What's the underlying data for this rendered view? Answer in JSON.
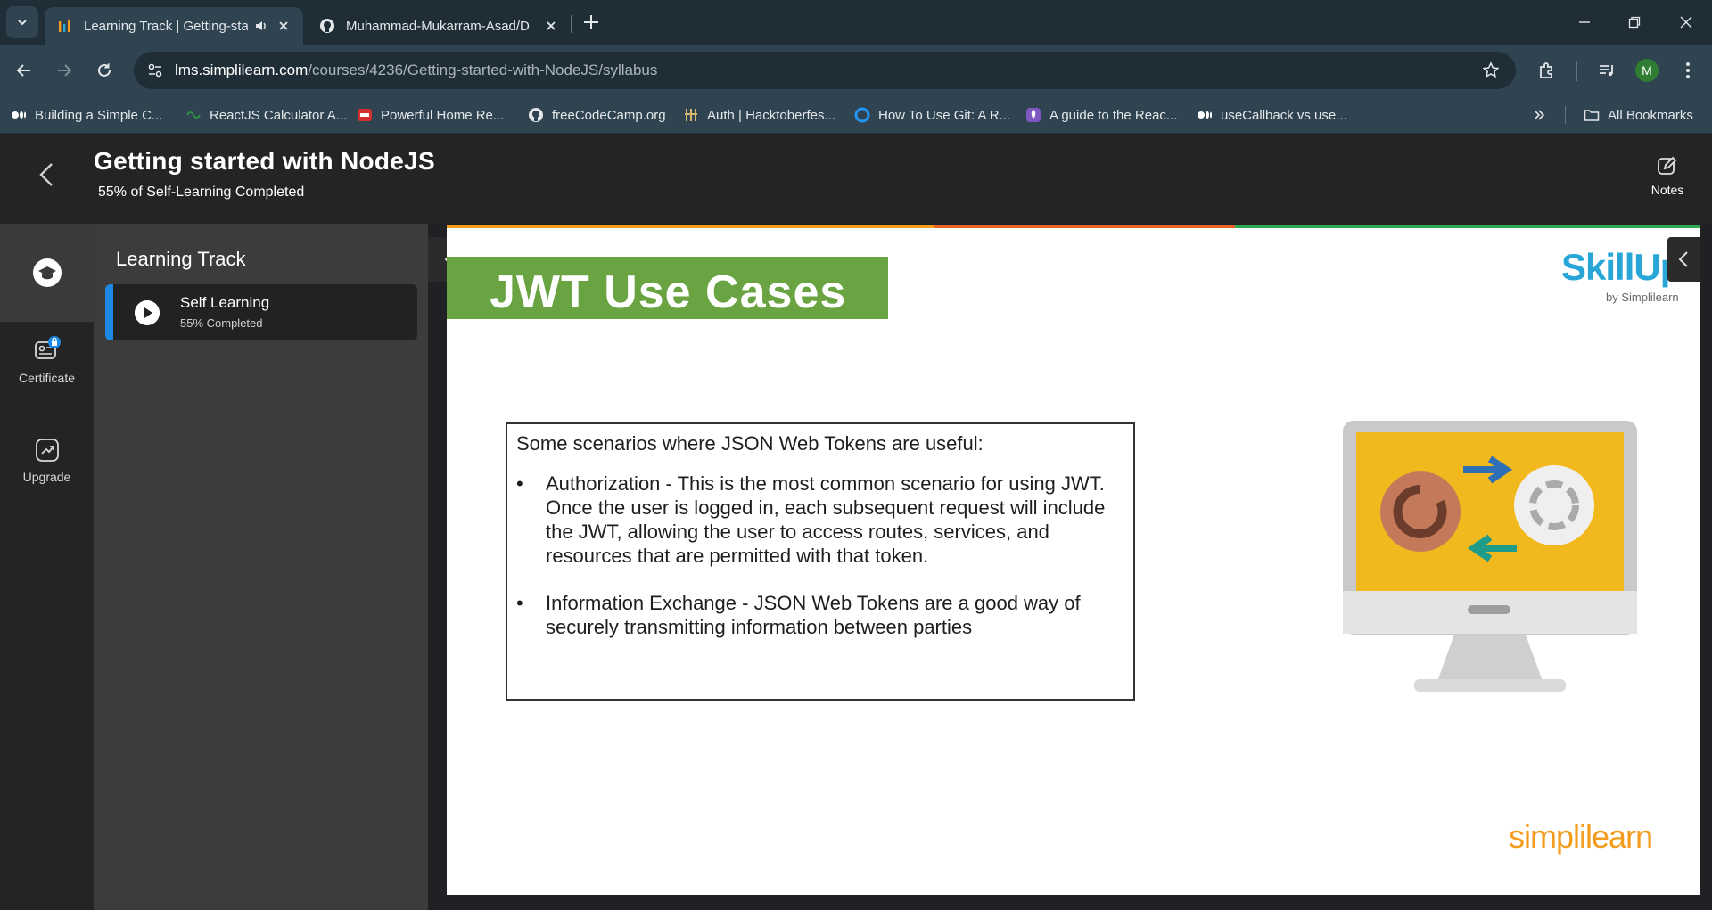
{
  "browser": {
    "tabs": [
      {
        "title": "Learning Track | Getting-star",
        "active": true,
        "icon": "simplilearn-favicon-icon"
      },
      {
        "title": "Muhammad-Mukarram-Asad/D",
        "active": false,
        "icon": "github-icon"
      }
    ],
    "url_domain": "lms.simplilearn.com",
    "url_path": "/courses/4236/Getting-started-with-NodeJS/syllabus",
    "profile_initial": "M",
    "bookmarks": [
      {
        "label": "Building a Simple C...",
        "icon": "medium-icon"
      },
      {
        "label": "ReactJS Calculator A...",
        "icon": "geeks-icon"
      },
      {
        "label": "Powerful Home Re...",
        "icon": "red-site-icon"
      },
      {
        "label": "freeCodeCamp.org",
        "icon": "github-icon"
      },
      {
        "label": "Auth | Hacktoberfes...",
        "icon": "hacktoberfest-icon"
      },
      {
        "label": "How To Use Git: A R...",
        "icon": "blue-site-icon"
      },
      {
        "label": "A guide to the Reac...",
        "icon": "rocket-icon"
      },
      {
        "label": "useCallback vs use...",
        "icon": "medium-icon"
      }
    ],
    "all_bookmarks": "All Bookmarks"
  },
  "course": {
    "title": "Getting started with NodeJS",
    "progress_text": "55% of Self-Learning Completed",
    "notes_label": "Notes"
  },
  "nav": {
    "certificate": "Certificate",
    "upgrade": "Upgrade"
  },
  "panel": {
    "title": "Learning Track",
    "item_label": "Self Learning",
    "item_progress": "55% Completed"
  },
  "slide": {
    "title": "JWT Use Cases",
    "brand": "SkillUp",
    "brand_by": "by Simplilearn",
    "intro": "Some scenarios where JSON Web Tokens are useful:",
    "bullets": [
      "Authorization - This is the most common scenario for using JWT. Once the user is logged in, each subsequent request will include the JWT, allowing the user to access routes, services, and resources that are permitted with that token.",
      "Information Exchange - JSON Web Tokens are a good way of securely transmitting information between parties"
    ],
    "footer_logo": "simplilearn"
  },
  "colors": {
    "accent_blue": "#1e88e5",
    "slide_green": "#6aa442",
    "skillup_blue": "#29a6d8",
    "simplilearn_orange": "#f39c1e"
  }
}
